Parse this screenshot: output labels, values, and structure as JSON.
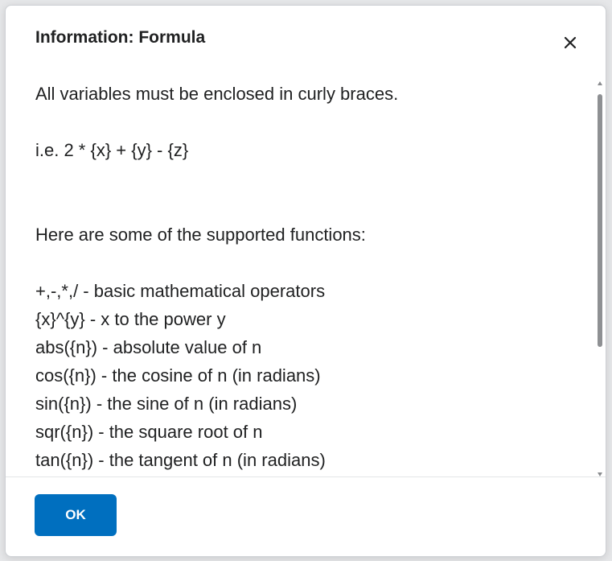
{
  "dialog": {
    "title": "Information: Formula",
    "close_icon": "close-icon",
    "intro": "All variables must be enclosed in curly braces.",
    "example": "i.e. 2 * {x} + {y} - {z}",
    "functions_heading": "Here are some of the supported functions:",
    "functions": [
      "+,-,*,/ - basic mathematical operators",
      "{x}^{y} - x to the power y",
      "abs({n}) - absolute value of n",
      "cos({n}) - the cosine of n (in radians)",
      "sin({n}) - the sine of n (in radians)",
      "sqr({n}) - the square root of n",
      "tan({n}) - the tangent of n (in radians)"
    ],
    "ok_label": "OK"
  },
  "colors": {
    "primary_button": "#006fbf",
    "text": "#202122"
  }
}
